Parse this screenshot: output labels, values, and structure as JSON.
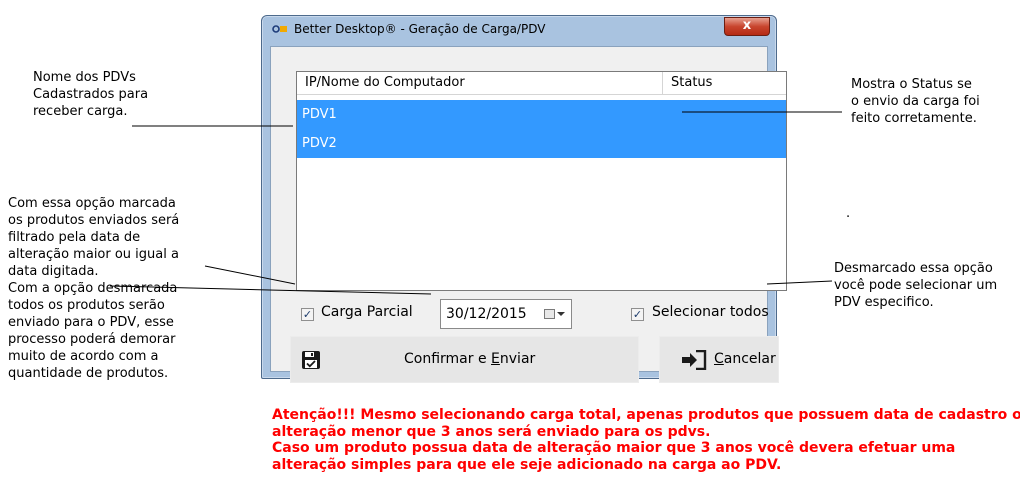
{
  "window": {
    "title": "Better Desktop® - Geração de Carga/PDV",
    "close_label": "x"
  },
  "list": {
    "columns": [
      "IP/Nome do Computador",
      "Status"
    ],
    "rows": [
      {
        "name": "PDV1",
        "status": ""
      },
      {
        "name": "PDV2",
        "status": ""
      }
    ]
  },
  "carga_parcial": {
    "label": "Carga Parcial",
    "checked": true,
    "check_mark": "✓"
  },
  "date": {
    "value": "30/12/2015"
  },
  "selecionar_todos": {
    "label": "Selecionar todos",
    "checked": true,
    "check_mark": "✓"
  },
  "buttons": {
    "confirm": {
      "prefix": "Confirmar e ",
      "mnemonic": "E",
      "suffix": "nviar"
    },
    "cancel": {
      "prefix": "",
      "mnemonic": "C",
      "suffix": "ancelar"
    }
  },
  "annotations": {
    "pdvs": [
      "Nome dos PDVs",
      "Cadastrados para",
      "receber carga."
    ],
    "status": [
      "Mostra o Status se",
      "o envio da carga foi",
      "feito corretamente."
    ],
    "parcial": [
      "Com essa opção marcada",
      "os produtos enviados será",
      "filtrado pela data de",
      "alteração maior ou igual a",
      "data digitada.",
      "Com a opção desmarcada",
      "todos os produtos serão",
      "enviado para o PDV, esse",
      "processo poderá demorar",
      "muito de acordo com a",
      "quantidade de produtos."
    ],
    "selecionar": [
      "Desmarcado essa opção",
      "você pode selecionar um",
      "PDV especifico."
    ],
    "dot": "."
  },
  "warning": [
    "Atenção!!! Mesmo selecionando carga total, apenas produtos que possuem data de cadastro ou",
    "alteração menor que 3 anos será enviado para os pdvs.",
    "Caso um produto possua data de alteração maior que 3 anos você devera efetuar uma",
    "alteração simples para que ele seje adicionado na carga ao PDV."
  ]
}
